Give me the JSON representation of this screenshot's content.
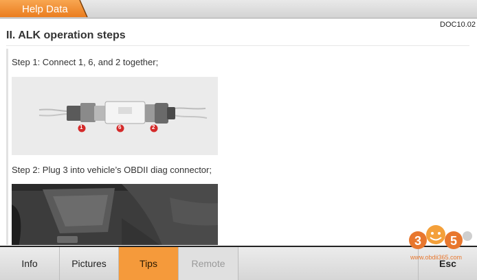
{
  "header": {
    "title": "Help Data"
  },
  "document": {
    "id": "DOC10.02",
    "heading": "II. ALK operation steps",
    "step1": "Step 1: Connect 1, 6, and 2 together;",
    "step2": "Step 2: Plug 3 into vehicle’s OBDII diag connector;",
    "connector_labels": [
      "1",
      "6",
      "2"
    ]
  },
  "toolbar": {
    "info": "Info",
    "pictures": "Pictures",
    "tips": "Tips",
    "remote": "Remote",
    "esc": "Esc",
    "active": "Tips"
  },
  "watermark": {
    "logo": "305",
    "url": "www.obdii365.com"
  },
  "colors": {
    "accent": "#f59a3b",
    "marker_red": "#d42a2a"
  }
}
